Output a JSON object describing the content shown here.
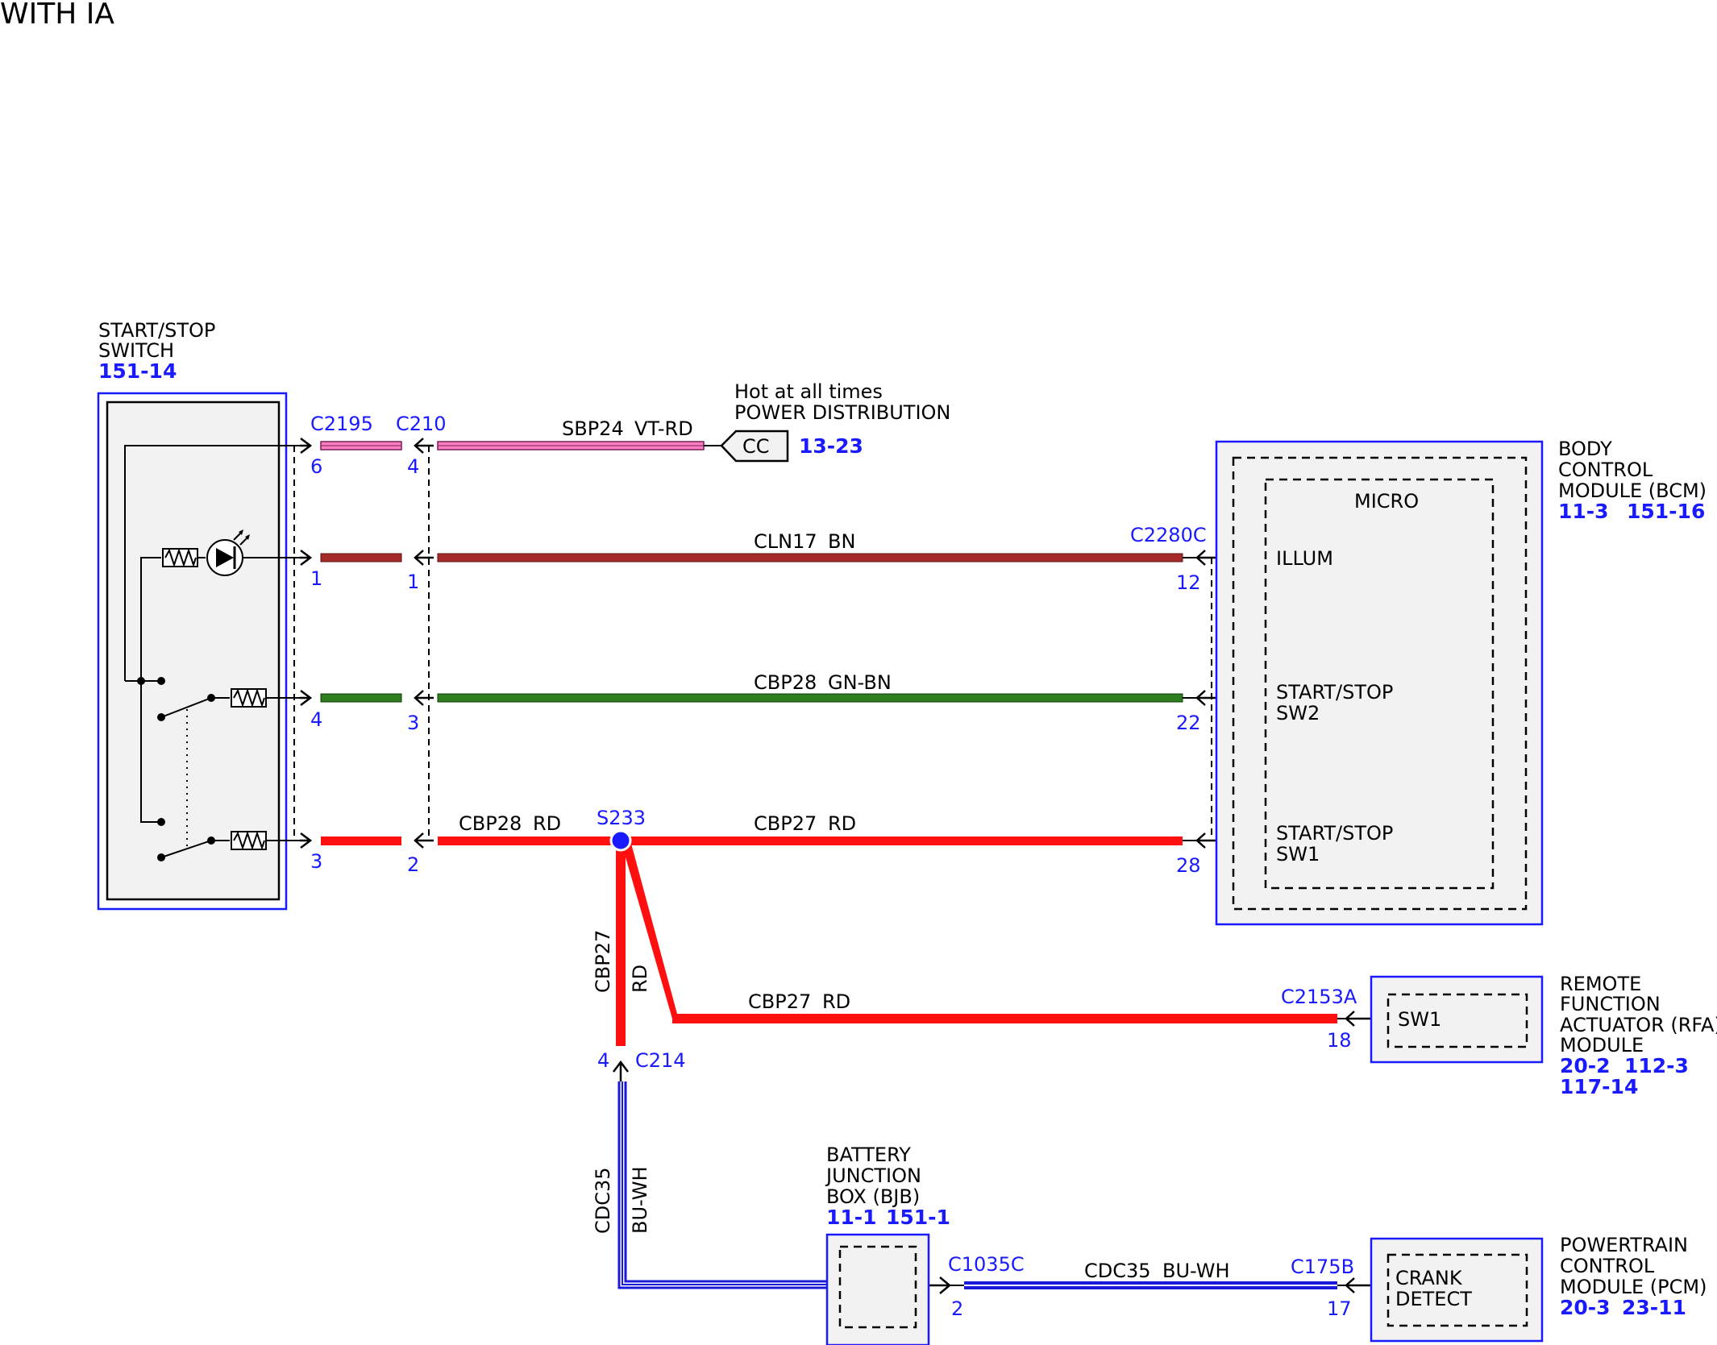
{
  "title": "WITH IA",
  "colors": {
    "blue": "#1a1aff",
    "pink": "#ff80c0",
    "brown": "#a52a2a",
    "green": "#2e7d1e",
    "red": "#ff1010",
    "blue_wire": "#1a1ad9",
    "box_fill": "#f2f2f2"
  },
  "components": {
    "switch": {
      "name_line1": "START/STOP",
      "name_line2": "SWITCH",
      "ref": "151-14"
    },
    "power": {
      "line1": "Hot at all times",
      "line2": "POWER DISTRIBUTION",
      "box": "CC",
      "ref": "13-23"
    },
    "bcm": {
      "name_line1": "BODY",
      "name_line2": "CONTROL",
      "name_line3": "MODULE (BCM)",
      "ref1": "11-3",
      "ref2": "151-16",
      "micro": "MICRO",
      "illum": "ILLUM",
      "sw2_line1": "START/STOP",
      "sw2_line2": "SW2",
      "sw1_line1": "START/STOP",
      "sw1_line2": "SW1"
    },
    "rfa": {
      "name_line1": "REMOTE",
      "name_line2": "FUNCTION",
      "name_line3": "ACTUATOR (RFA)",
      "name_line4": "MODULE",
      "ref1": "20-2",
      "ref2": "112-3",
      "ref3": "117-14",
      "sw": "SW1"
    },
    "bjb": {
      "name_line1": "BATTERY",
      "name_line2": "JUNCTION",
      "name_line3": "BOX (BJB)",
      "ref1": "11-1",
      "ref2": "151-1"
    },
    "pcm": {
      "name_line1": "POWERTRAIN",
      "name_line2": "CONTROL",
      "name_line3": "MODULE (PCM)",
      "ref1": "20-3",
      "ref2": "23-11",
      "crank1": "CRANK",
      "crank2": "DETECT"
    }
  },
  "connectors": {
    "c2195": "C2195",
    "c210": "C210",
    "c2280c": "C2280C",
    "s233": "S233",
    "c2153a": "C2153A",
    "c214": "C214",
    "c1035c": "C1035C",
    "c175b": "C175B"
  },
  "pins": {
    "c2195_a": "6",
    "c2195_b": "1",
    "c2195_c": "4",
    "c2195_d": "3",
    "c210_a": "4",
    "c210_b": "1",
    "c210_c": "3",
    "c210_d": "2",
    "bcm_a": "12",
    "bcm_b": "22",
    "bcm_c": "28",
    "rfa": "18",
    "c214": "4",
    "c1035c": "2",
    "c175b": "17"
  },
  "wires": {
    "w1_circuit": "SBP24",
    "w1_color": "VT-RD",
    "w2_circuit": "CLN17",
    "w2_color": "BN",
    "w3_circuit": "CBP28",
    "w3_color": "GN-BN",
    "w4a_circuit": "CBP28",
    "w4a_color": "RD",
    "w4b_circuit": "CBP27",
    "w4b_color": "RD",
    "w5_circuit": "CBP27",
    "w5_color": "RD",
    "w6_circuit": "CBP27",
    "w6_color": "RD",
    "w7_circuit": "CDC35",
    "w7_color": "BU-WH",
    "w8_circuit": "CDC35",
    "w8_color": "BU-WH"
  }
}
